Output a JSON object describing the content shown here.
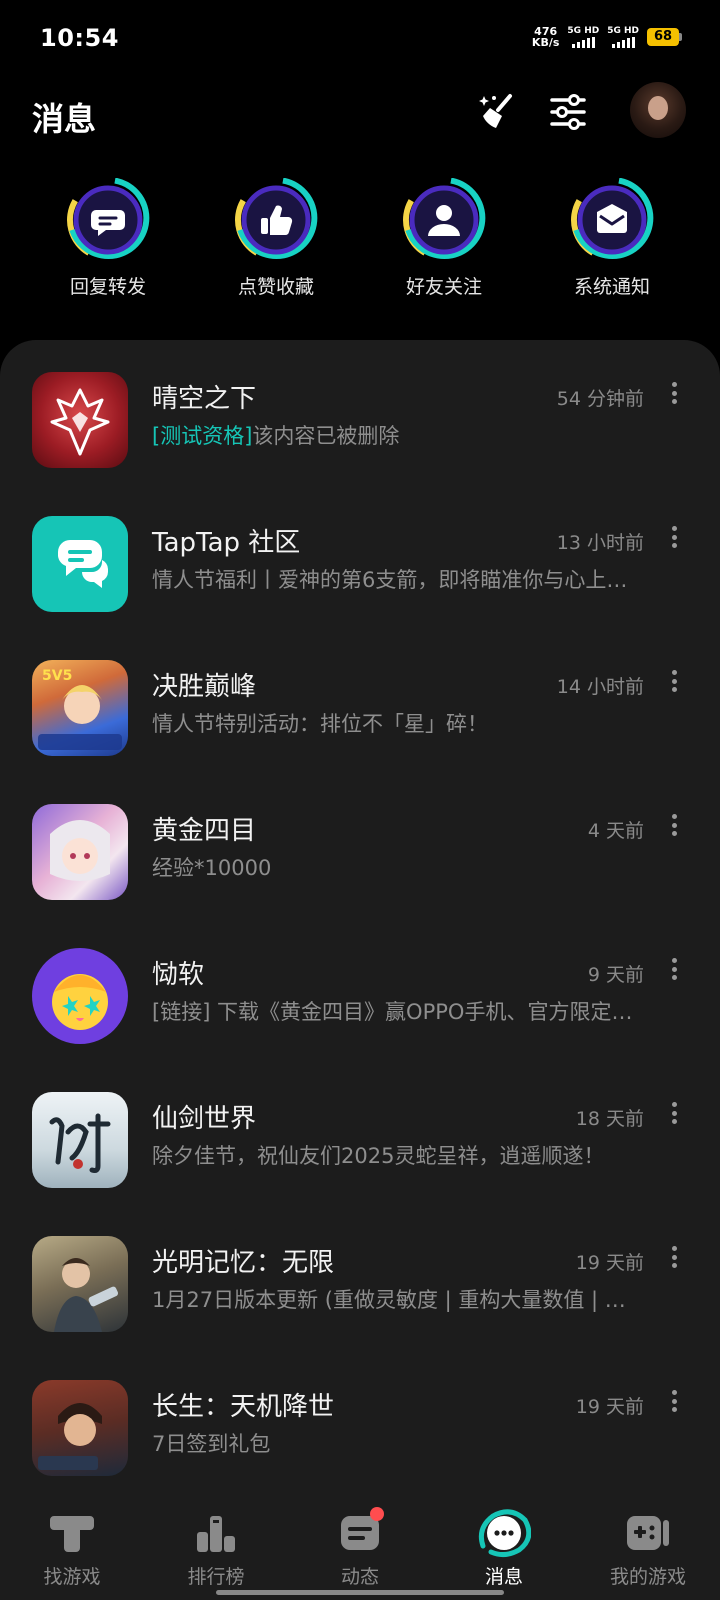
{
  "status_bar": {
    "time": "10:54",
    "net_speed_value": "476",
    "net_speed_unit": "KB/s",
    "sim1_label": "5G HD",
    "sim2_label": "5G HD",
    "battery": "68"
  },
  "header": {
    "title": "消息",
    "clean_icon": "broom-sparkle-icon",
    "settings_icon": "sliders-icon"
  },
  "categories": [
    {
      "label": "回复转发",
      "icon": "chat-bubble-icon"
    },
    {
      "label": "点赞收藏",
      "icon": "thumbs-up-icon"
    },
    {
      "label": "好友关注",
      "icon": "person-icon"
    },
    {
      "label": "系统通知",
      "icon": "envelope-icon"
    }
  ],
  "messages": [
    {
      "title": "晴空之下",
      "time": "54 分钟前",
      "tag": "[测试资格]",
      "preview": "该内容已被删除"
    },
    {
      "title": "TapTap 社区",
      "time": "13 小时前",
      "tag": "",
      "preview": "情人节福利丨爱神的第6支箭，即将瞄准你与心上…"
    },
    {
      "title": "决胜巅峰",
      "time": "14 小时前",
      "tag": "",
      "preview": "情人节特别活动：排位不「星」碎！"
    },
    {
      "title": "黄金四目",
      "time": "4 天前",
      "tag": "",
      "preview": "经验*10000"
    },
    {
      "title": "恸软",
      "time": "9 天前",
      "tag": "",
      "preview": "[链接] 下载《黄金四目》赢OPPO手机、官方限定…"
    },
    {
      "title": "仙剑世界",
      "time": "18 天前",
      "tag": "",
      "preview": "除夕佳节，祝仙友们2025灵蛇呈祥，逍遥顺遂！"
    },
    {
      "title": "光明记忆：无限",
      "time": "19 天前",
      "tag": "",
      "preview": "1月27日版本更新 (重做灵敏度 | 重构大量数值 | …"
    },
    {
      "title": "长生：天机降世",
      "time": "19 天前",
      "tag": "",
      "preview": "7日签到礼包"
    }
  ],
  "bottom_nav": [
    {
      "label": "找游戏",
      "icon": "taptap-t-icon"
    },
    {
      "label": "排行榜",
      "icon": "ranking-icon"
    },
    {
      "label": "动态",
      "icon": "feed-icon"
    },
    {
      "label": "消息",
      "icon": "message-icon"
    },
    {
      "label": "我的游戏",
      "icon": "gamepad-icon"
    }
  ],
  "colors": {
    "accent": "#16c5b6",
    "ring_purple": "#4a2bbf",
    "ring_teal": "#18d2c4",
    "ring_yellow": "#f5d547",
    "badge_red": "#ff4d4f"
  }
}
